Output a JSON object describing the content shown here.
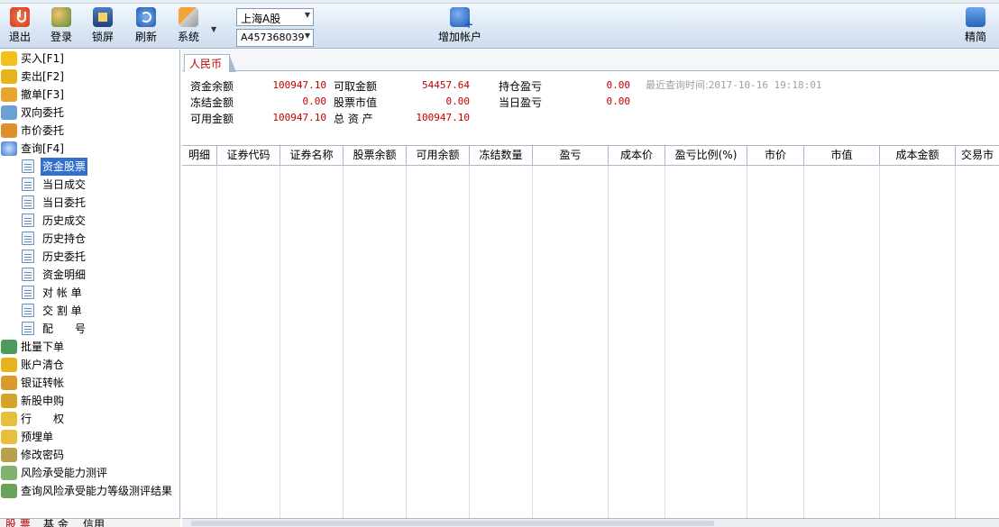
{
  "toolbar": {
    "exit": "退出",
    "login": "登录",
    "lock": "锁屏",
    "refresh": "刷新",
    "system": "系统",
    "market_select": "上海A股",
    "account_select": "A457368039",
    "add_account": "增加帐户",
    "simple": "精简"
  },
  "sidebar": {
    "buy": "买入[F1]",
    "sell": "卖出[F2]",
    "cancel": "撤单[F3]",
    "bidirectional": "双向委托",
    "market_order": "市价委托",
    "query": "查询[F4]",
    "query_items": [
      "资金股票",
      "当日成交",
      "当日委托",
      "历史成交",
      "历史持仓",
      "历史委托",
      "资金明细",
      "对 帐 单",
      "交 割 单",
      "配　　号"
    ],
    "batch": "批量下单",
    "clear_position": "账户清仓",
    "bank_transfer": "银证转帐",
    "ipo": "新股申购",
    "exercise": "行　　权",
    "prepared": "预埋单",
    "change_password": "修改密码",
    "risk_test": "风险承受能力测评",
    "risk_result": "查询风险承受能力等级测评结果"
  },
  "bottom_tabs": [
    "股 票",
    "基 金",
    "信用"
  ],
  "main": {
    "currency_tab": "人民币",
    "summary": {
      "fund_balance_label": "资金余额",
      "fund_balance": "100947.10",
      "frozen_label": "冻结金额",
      "frozen": "0.00",
      "available_label": "可用金额",
      "available": "100947.10",
      "withdrawable_label": "可取金额",
      "withdrawable": "54457.64",
      "stock_value_label": "股票市值",
      "stock_value": "0.00",
      "total_assets_label": "总 资 产",
      "total_assets": "100947.10",
      "position_pl_label": "持仓盈亏",
      "position_pl": "0.00",
      "today_pl_label": "当日盈亏",
      "today_pl": "0.00",
      "last_query_label": "最近查询时间:",
      "last_query_time": "2017-10-16 19:18:01"
    },
    "columns": [
      "明细",
      "证券代码",
      "证券名称",
      "股票余额",
      "可用余额",
      "冻结数量",
      "盈亏",
      "成本价",
      "盈亏比例(%)",
      "市价",
      "市值",
      "成本金额",
      "交易市"
    ]
  },
  "colors": {
    "accent_red": "#c00000",
    "selection_blue": "#3370ce",
    "toolbar_bg": "#dbe7f6"
  }
}
